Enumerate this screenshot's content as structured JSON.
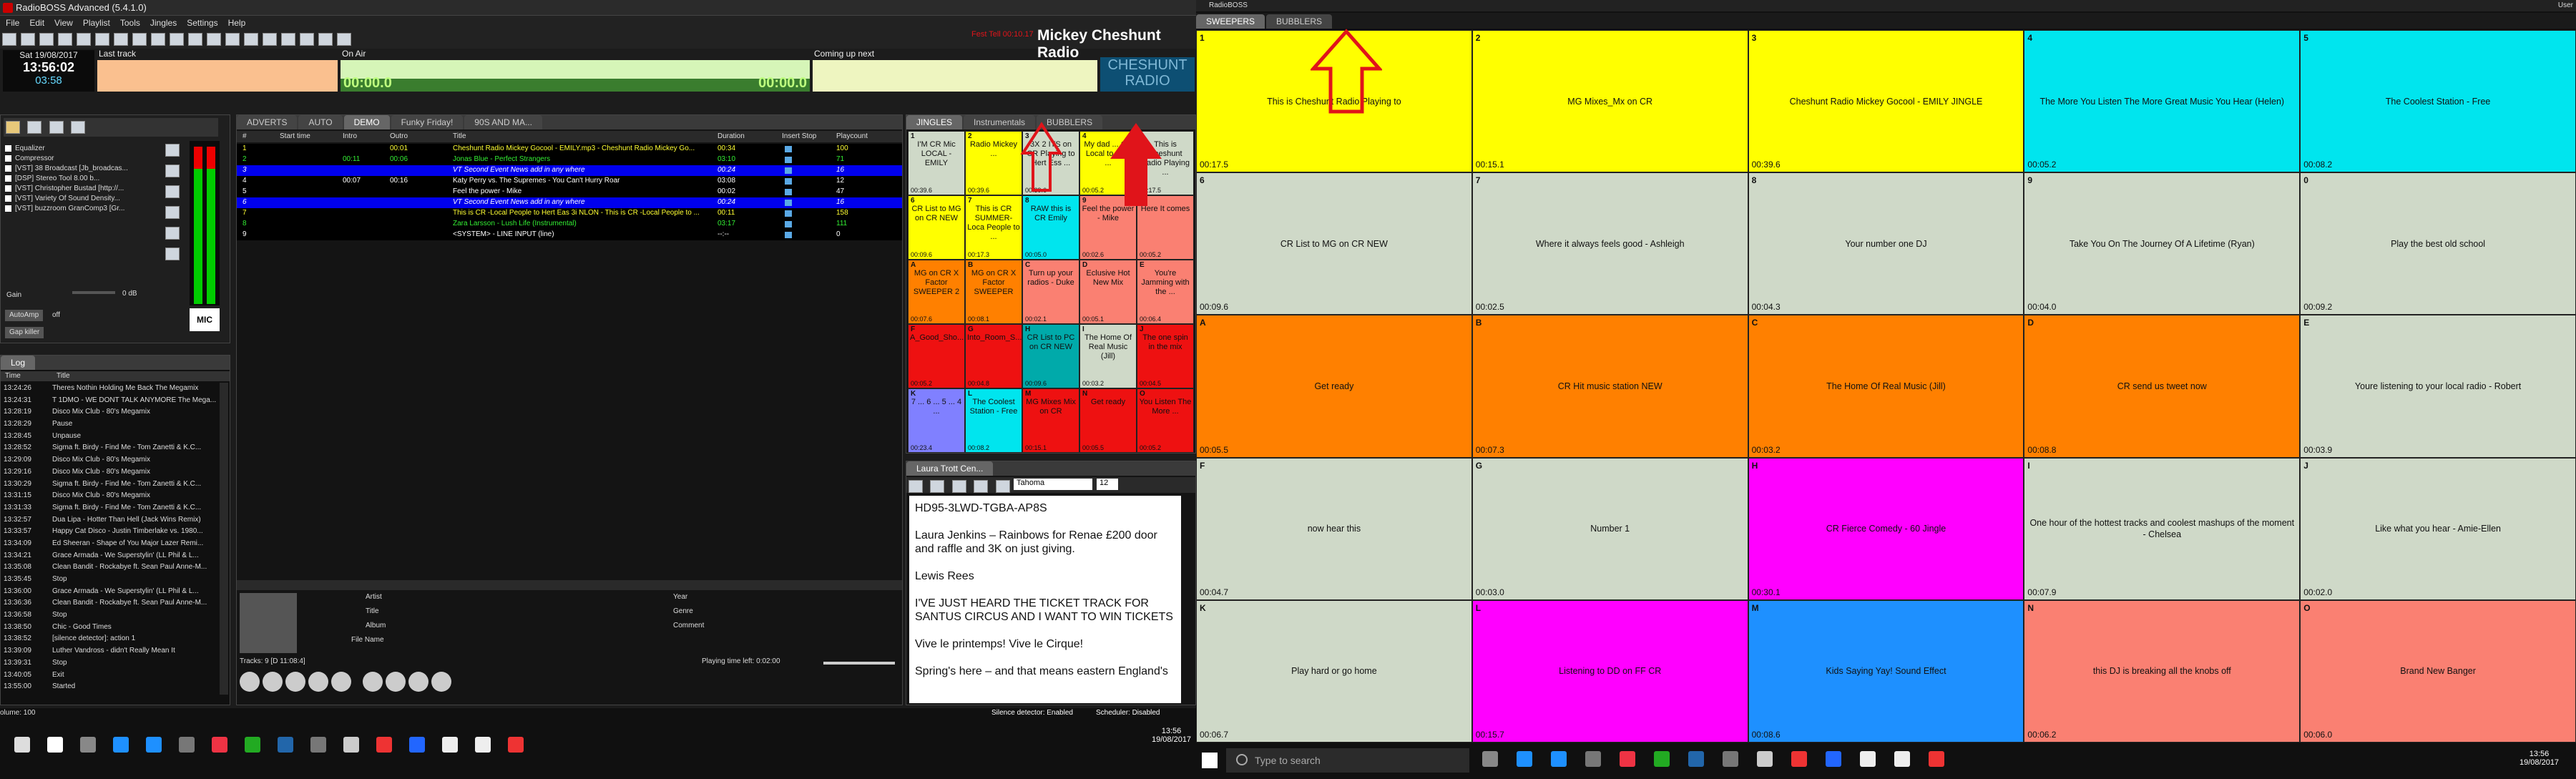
{
  "app": {
    "title": "RadioBOSS Advanced (5.4.1.0)",
    "title2": "RadioBOSS",
    "user": "User"
  },
  "menu": [
    "File",
    "Edit",
    "View",
    "Playlist",
    "Tools",
    "Jingles",
    "Settings",
    "Help"
  ],
  "header": {
    "date": "Sat 19/08/2017",
    "time": "13:56:02",
    "countdown": "03:58",
    "last_track_label": "Last track",
    "on_air_label": "On Air",
    "coming_up_label": "Coming up next",
    "on_air_time1": "00:00.0",
    "on_air_time2": "00:00.0",
    "station": "Mickey Cheshunt Radio",
    "red_text": "Fest Tell 00:10.17",
    "logo_line1": "CHESHUNT",
    "logo_line2": "RADIO"
  },
  "effects": {
    "items": [
      "Equalizer",
      "Compressor",
      "[VST] 38 Broadcast [Jb_broadcas...",
      "[DSP] Stereo Tool 8.00 b...",
      "[VST] Christopher Bustad [http://...",
      "[VST] Variety Of Sound Density...",
      "[VST] buzzroom GranComp3 [Gr..."
    ],
    "gain_label": "Gain",
    "gain_value": "0 dB",
    "autoamp_label": "AutoAmp",
    "autoamp_value": "off",
    "gap_killer": "Gap killer",
    "mic_label": "MIC"
  },
  "log": {
    "title": "Log",
    "col_time": "Time",
    "col_title": "Title",
    "rows": [
      [
        "13:24:26",
        "Theres Nothin Holding Me Back The Megamix"
      ],
      [
        "13:24:31",
        "T 1DMO - WE DONT TALK ANYMORE The Mega..."
      ],
      [
        "13:28:19",
        "Disco Mix Club - 80's Megamix"
      ],
      [
        "13:28:29",
        "Pause"
      ],
      [
        "13:28:45",
        "Unpause"
      ],
      [
        "13:28:52",
        "Sigma  ft. Birdy - Find Me - Tom Zanetti & K.C..."
      ],
      [
        "13:29:09",
        "Disco Mix Club - 80's Megamix"
      ],
      [
        "13:29:16",
        "Disco Mix Club - 80's Megamix"
      ],
      [
        "13:30:29",
        "Sigma  ft. Birdy - Find Me - Tom Zanetti & K.C..."
      ],
      [
        "13:31:15",
        "Disco Mix Club - 80's Megamix"
      ],
      [
        "13:31:33",
        "Sigma  ft. Birdy - Find Me - Tom Zanetti & K.C..."
      ],
      [
        "13:32:57",
        "Dua Lipa - Hotter Than Hell (Jack Wins Remix)"
      ],
      [
        "13:33:57",
        "Happy Cat Disco - Justin Timberlake vs. 1980..."
      ],
      [
        "13:34:09",
        "Ed Sheeran - Shape of You Major Lazer Remi..."
      ],
      [
        "13:34:21",
        "Grace Armada - We Superstylin' (LL Phil & L..."
      ],
      [
        "13:35:08",
        "Clean Bandit - Rockabye ft. Sean Paul Anne-M..."
      ],
      [
        "13:35:45",
        "Stop"
      ],
      [
        "13:36:00",
        "Grace Armada - We Superstylin' (LL Phil & L..."
      ],
      [
        "13:36:36",
        "Clean Bandit - Rockabye ft. Sean Paul Anne-M..."
      ],
      [
        "13:36:58",
        "Stop"
      ],
      [
        "13:38:50",
        "Chic - Good Times"
      ],
      [
        "13:38:52",
        "[silence detector]: action 1"
      ],
      [
        "13:39:09",
        "Luther Vandross - didn't Really Mean It"
      ],
      [
        "13:39:31",
        "Stop"
      ],
      [
        "13:40:05",
        "Exit"
      ],
      [
        "13:55:00",
        "Started"
      ]
    ]
  },
  "playlist": {
    "tabs": [
      "ADVERTS",
      "AUTO",
      "DEMO",
      "Funky Friday!",
      "90S AND MA..."
    ],
    "columns": [
      "#",
      "Start time",
      "Intro",
      "Outro",
      "Title",
      "Duration",
      "Insert Stop",
      "Playcount"
    ],
    "rows": [
      {
        "n": "1",
        "start": "",
        "intro": "",
        "outro": "00:01",
        "title": "Cheshunt Radio Mickey Gocool - EMILY.mp3 - Cheshunt Radio Mickey Go...",
        "dur": "00:34",
        "play": "100",
        "style": "yel"
      },
      {
        "n": "2",
        "start": "",
        "intro": "00:11",
        "outro": "00:06",
        "title": "Jonas Blue - Perfect Strangers",
        "dur": "03:10",
        "play": "71",
        "style": "grn"
      },
      {
        "n": "3",
        "start": "",
        "intro": "",
        "outro": "",
        "title": "VT Second Event News add in any where",
        "dur": "00:24",
        "play": "16",
        "style": "blu"
      },
      {
        "n": "4",
        "start": "",
        "intro": "00:07",
        "outro": "00:16",
        "title": "Katy Perry vs. The Supremes - You Can't Hurry Roar",
        "dur": "03:08",
        "play": "12",
        "style": "nor"
      },
      {
        "n": "5",
        "start": "",
        "intro": "",
        "outro": "",
        "title": "Feel the power - Mike",
        "dur": "00:02",
        "play": "47",
        "style": "nor"
      },
      {
        "n": "6",
        "start": "",
        "intro": "",
        "outro": "",
        "title": "VT Second Event News add in any where",
        "dur": "00:24",
        "play": "16",
        "style": "blu"
      },
      {
        "n": "7",
        "start": "",
        "intro": "",
        "outro": "",
        "title": "This is CR -Local People to Hert Eas 3i NLON - This is CR -Local People to ...",
        "dur": "00:11",
        "play": "158",
        "style": "yel"
      },
      {
        "n": "8",
        "start": "",
        "intro": "",
        "outro": "",
        "title": "Zara Larsson - Lush Life (Instrumental)",
        "dur": "03:17",
        "play": "111",
        "style": "grn"
      },
      {
        "n": "9",
        "start": "",
        "intro": "",
        "outro": "",
        "title": "<SYSTEM> - LINE INPUT (line)",
        "dur": "--:--",
        "play": "0",
        "style": "nor"
      }
    ],
    "info_labels": [
      "Artist",
      "Title",
      "Album",
      "File Name",
      "Year",
      "Genre",
      "Comment"
    ],
    "tracks_info": "Tracks: 9 [D 11:08:4]",
    "time_left_label": "Playing time left: 0:02:00"
  },
  "small_jingles": {
    "tabs": [
      "JINGLES",
      "Instrumentals",
      "BUBBLERS"
    ],
    "cells": [
      {
        "k": "1",
        "t": "I'M CR Mic LOCAL - EMILY",
        "tm": "00:39.6",
        "c": "#cfd9c8"
      },
      {
        "k": "2",
        "t": "Radio Mickey ...",
        "tm": "00:39.6",
        "c": "#ffff00"
      },
      {
        "k": "3",
        "t": "3X 2 ITS on CR Playing to Hert Ess ...",
        "tm": "00:39.6",
        "c": "#cfd9c8"
      },
      {
        "k": "4",
        "t": "My dad ... CR Local to Hert ...",
        "tm": "00:05.2",
        "c": "#ffff00"
      },
      {
        "k": "5",
        "t": "This is Cheshunt Radio Playing ...",
        "tm": "00:17.5",
        "c": "#cfd9c8"
      },
      {
        "k": "6",
        "t": "CR List to MG on CR NEW",
        "tm": "00:09.6",
        "c": "#ffff00"
      },
      {
        "k": "7",
        "t": "This is CR SUMMER-Loca People to ...",
        "tm": "00:17.3",
        "c": "#ffff00"
      },
      {
        "k": "8",
        "t": "RAW this is CR Emily",
        "tm": "00:05.0",
        "c": "#00e5ee"
      },
      {
        "k": "9",
        "t": "Feel the power - Mike",
        "tm": "00:02.6",
        "c": "#fa8072"
      },
      {
        "k": "0",
        "t": "Here It comes",
        "tm": "00:05.2",
        "c": "#fa8072"
      },
      {
        "k": "A",
        "t": "MG on CR X Factor SWEEPER 2",
        "tm": "00:07.6",
        "c": "#ff8000"
      },
      {
        "k": "B",
        "t": "MG on CR X Factor SWEEPER",
        "tm": "00:08.1",
        "c": "#ff8000"
      },
      {
        "k": "C",
        "t": "Turn up your radios - Duke",
        "tm": "00:02.1",
        "c": "#fa8072"
      },
      {
        "k": "D",
        "t": "Eclusive Hot New Mix",
        "tm": "00:05.1",
        "c": "#fa8072"
      },
      {
        "k": "E",
        "t": "You're Jamming with the ...",
        "tm": "00:06.4",
        "c": "#fa8072"
      },
      {
        "k": "F",
        "t": "A_Good_Sho...",
        "tm": "00:05.2",
        "c": "#ee1111"
      },
      {
        "k": "G",
        "t": "Into_Room_S...",
        "tm": "00:04.8",
        "c": "#ee1111"
      },
      {
        "k": "H",
        "t": "CR List to PC on CR NEW",
        "tm": "00:09.6",
        "c": "#00aaaa"
      },
      {
        "k": "I",
        "t": "The Home Of Real Music (Jill)",
        "tm": "00:03.2",
        "c": "#cfd9c8"
      },
      {
        "k": "J",
        "t": "The one spin in the mix",
        "tm": "00:04.5",
        "c": "#ee1111"
      },
      {
        "k": "K",
        "t": "7 ... 6 ... 5 ... 4 ...",
        "tm": "00:23.4",
        "c": "#8080ff"
      },
      {
        "k": "L",
        "t": "The Coolest Station - Free",
        "tm": "00:08.2",
        "c": "#00e5ee"
      },
      {
        "k": "M",
        "t": "MG Mixes Mix on CR",
        "tm": "00:15.1",
        "c": "#ee1111"
      },
      {
        "k": "N",
        "t": "Get ready",
        "tm": "00:05.5",
        "c": "#ee1111"
      },
      {
        "k": "O",
        "t": "You Listen The More ...",
        "tm": "00:05.2",
        "c": "#ee1111"
      }
    ]
  },
  "notes": {
    "tab": "Laura Trott Cen...",
    "font": "Tahoma",
    "size": "12",
    "lines": [
      "HD95-3LWD-TGBA-AP8S",
      "",
      "Laura Jenkins – Rainbows for Renae £200 door and raffle and 3K on just giving.",
      "",
      "Lewis Rees",
      "",
      "I'VE JUST HEARD THE TICKET TRACK FOR SANTUS CIRCUS AND I WANT TO WIN TICKETS",
      "",
      "Vive le printemps!   Vive le Cirque!",
      "",
      "Spring's here – and that means eastern England's"
    ]
  },
  "status": {
    "volume": "olume: 100",
    "silence": "Silence detector: Enabled",
    "scheduler": "Scheduler: Disabled",
    "clock": "13:56",
    "date": "19/08/2017"
  },
  "big": {
    "tabs": [
      "SWEEPERS",
      "BUBBLERS"
    ],
    "cells": [
      {
        "k": "1",
        "t": "This is Cheshunt Radio Playing to",
        "tm": "00:17.5",
        "c": "#ffff00"
      },
      {
        "k": "2",
        "t": "MG Mixes_Mx on CR",
        "tm": "00:15.1",
        "c": "#ffff00"
      },
      {
        "k": "3",
        "t": "Cheshunt Radio Mickey Gocool - EMILY JINGLE",
        "tm": "00:39.6",
        "c": "#ffff00"
      },
      {
        "k": "4",
        "t": "The More You Listen The More Great Music You Hear (Helen)",
        "tm": "00:05.2",
        "c": "#00e5ee"
      },
      {
        "k": "5",
        "t": "The Coolest Station - Free",
        "tm": "00:08.2",
        "c": "#00e5ee"
      },
      {
        "k": "6",
        "t": "CR List to MG on CR NEW",
        "tm": "00:09.6",
        "c": "#cfd9c8"
      },
      {
        "k": "7",
        "t": "Where it always feels good - Ashleigh",
        "tm": "00:02.5",
        "c": "#cfd9c8"
      },
      {
        "k": "8",
        "t": "Your number one DJ",
        "tm": "00:04.3",
        "c": "#cfd9c8"
      },
      {
        "k": "9",
        "t": "Take You On The Journey Of A Lifetime (Ryan)",
        "tm": "00:04.0",
        "c": "#cfd9c8"
      },
      {
        "k": "0",
        "t": "Play the best old school",
        "tm": "00:09.2",
        "c": "#cfd9c8"
      },
      {
        "k": "A",
        "t": "Get ready",
        "tm": "00:05.5",
        "c": "#ff8000"
      },
      {
        "k": "B",
        "t": "CR Hit music station NEW",
        "tm": "00:07.3",
        "c": "#ff8000"
      },
      {
        "k": "C",
        "t": "The Home Of Real Music (Jill)",
        "tm": "00:03.2",
        "c": "#ff8000"
      },
      {
        "k": "D",
        "t": "CR send us tweet now",
        "tm": "00:08.8",
        "c": "#ff8000"
      },
      {
        "k": "E",
        "t": "Youre listening to your local radio - Robert",
        "tm": "00:03.9",
        "c": "#cfd9c8"
      },
      {
        "k": "F",
        "t": "now hear this",
        "tm": "00:04.7",
        "c": "#cfd9c8"
      },
      {
        "k": "G",
        "t": "Number 1",
        "tm": "00:03.0",
        "c": "#cfd9c8"
      },
      {
        "k": "H",
        "t": "CR Fierce Comedy - 60 Jingle",
        "tm": "00:30.1",
        "c": "#ff00ff"
      },
      {
        "k": "I",
        "t": "One hour of the hottest tracks and coolest mashups of the moment - Chelsea",
        "tm": "00:07.9",
        "c": "#cfd9c8"
      },
      {
        "k": "J",
        "t": "Like what you hear - Amie-Ellen",
        "tm": "00:02.0",
        "c": "#cfd9c8"
      },
      {
        "k": "K",
        "t": "Play hard or go home",
        "tm": "00:06.7",
        "c": "#cfd9c8"
      },
      {
        "k": "L",
        "t": "Listening to DD on FF CR",
        "tm": "00:15.7",
        "c": "#ff00ff"
      },
      {
        "k": "M",
        "t": "Kids Saying Yay! Sound Effect",
        "tm": "00:08.6",
        "c": "#1e90ff"
      },
      {
        "k": "N",
        "t": "this DJ is breaking all the knobs off",
        "tm": "00:06.2",
        "c": "#fa8072"
      },
      {
        "k": "O",
        "t": "Brand New Banger",
        "tm": "00:06.0",
        "c": "#fa8072"
      }
    ]
  },
  "taskbar": {
    "search_placeholder": "Type to search",
    "clock": "13:56",
    "date": "19/08/2017"
  },
  "colors": {
    "accent_red": "#e0141a",
    "on_air_green": "#d6f5b8",
    "last_track": "#fac08f",
    "coming_up": "#eef5c0"
  }
}
